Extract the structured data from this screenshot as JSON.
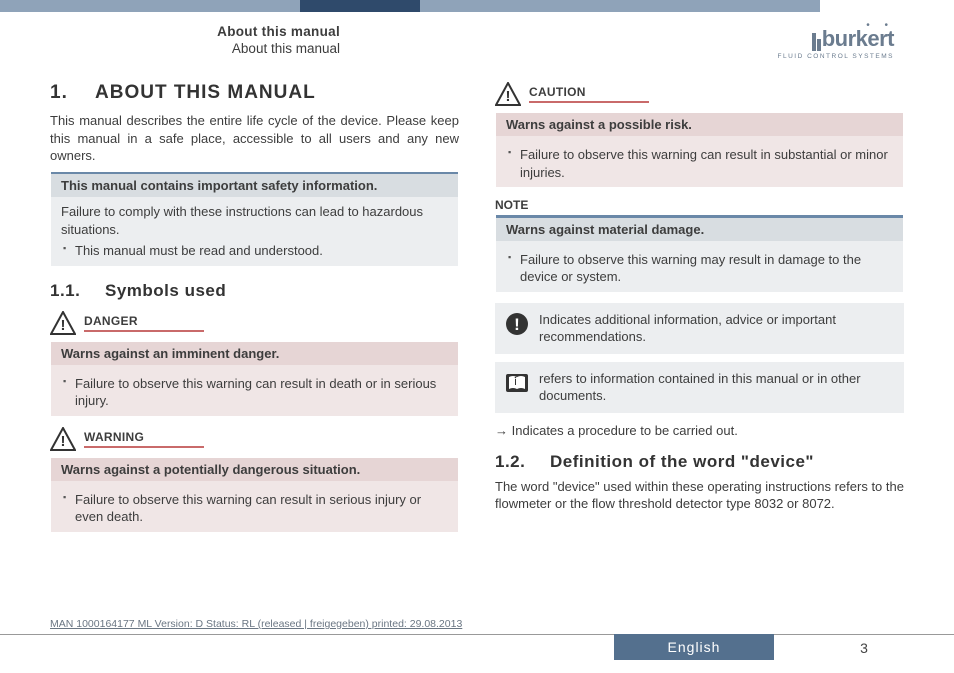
{
  "header": {
    "title_bold": "About this manual",
    "title_sub": "About this manual",
    "logo_name": "burkert",
    "logo_sub": "FLUID CONTROL SYSTEMS"
  },
  "section1": {
    "num": "1.",
    "title": "ABOUT THIS MANUAL",
    "intro": "This manual describes the entire life cycle of the device. Please keep this manual in a safe place, accessible to all users and any new owners."
  },
  "safety_box": {
    "band": "This manual contains important safety information.",
    "body": "Failure to comply with these instructions can lead to hazardous situations.",
    "bullet": "This manual must be read and understood."
  },
  "section11": {
    "num": "1.1.",
    "title": "Symbols used"
  },
  "danger": {
    "label": "DANGER",
    "band": "Warns against an imminent danger.",
    "bullet": "Failure to observe this warning can result in death or in serious injury."
  },
  "warning": {
    "label": "WARNING",
    "band": "Warns against a potentially dangerous situation.",
    "bullet": "Failure to observe this warning can result in serious injury or even death."
  },
  "caution": {
    "label": "CAUTION",
    "band": "Warns against a possible risk.",
    "bullet": "Failure to observe this warning can result in substantial or minor injuries."
  },
  "note": {
    "label": "NOTE",
    "band": "Warns against material damage.",
    "bullet": "Failure to observe this warning may result in damage to the device or system."
  },
  "info_box": "Indicates additional information, advice or important recommendations.",
  "ref_box": "refers to information contained in this manual or in other documents.",
  "procedure": "Indicates a procedure to be carried out.",
  "section12": {
    "num": "1.2.",
    "title": "Definition of the word \"device\"",
    "body": "The word \"device\" used within these operating instructions refers to the flowmeter or the flow threshold detector type 8032 or 8072."
  },
  "footer": {
    "docinfo": "MAN 1000164177 ML Version: D Status: RL (released | freigegeben) printed: 29.08.2013",
    "language": "English",
    "page": "3"
  }
}
